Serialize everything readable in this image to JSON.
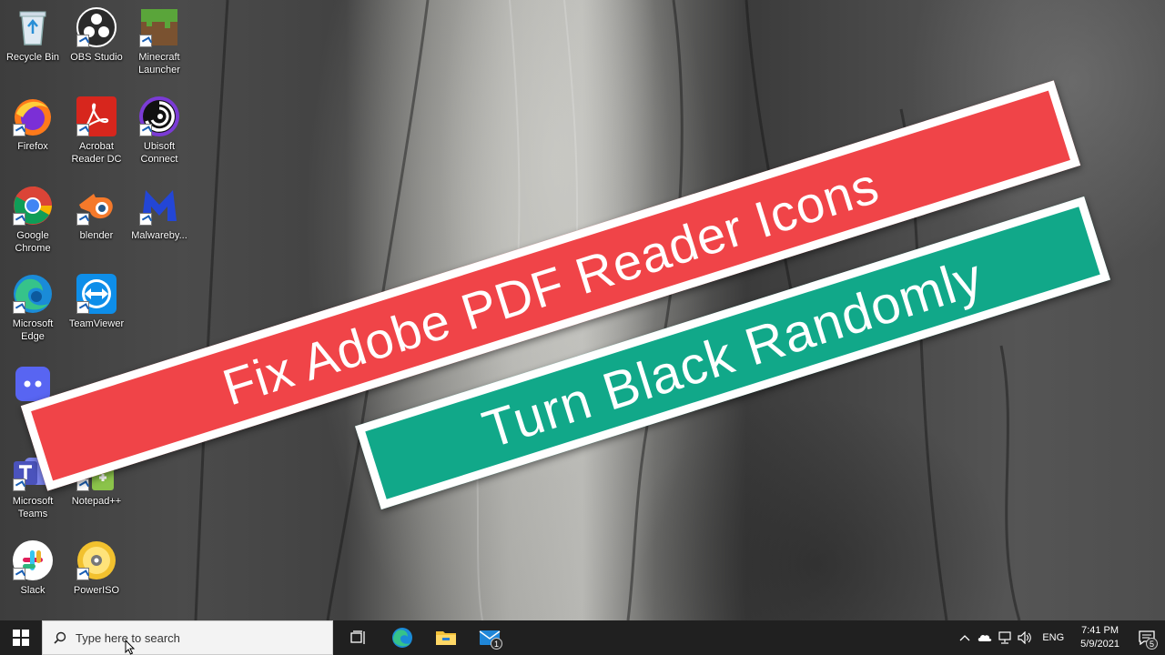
{
  "desktop": {
    "icons": [
      {
        "label": "Recycle Bin",
        "icon": "recycle-bin-icon"
      },
      {
        "label": "OBS Studio",
        "icon": "obs-studio-icon"
      },
      {
        "label": "Minecraft Launcher",
        "icon": "minecraft-icon"
      },
      {
        "label": "Firefox",
        "icon": "firefox-icon"
      },
      {
        "label": "Acrobat Reader DC",
        "icon": "acrobat-reader-icon"
      },
      {
        "label": "Ubisoft Connect",
        "icon": "ubisoft-icon"
      },
      {
        "label": "Google Chrome",
        "icon": "chrome-icon"
      },
      {
        "label": "blender",
        "icon": "blender-icon"
      },
      {
        "label": "Malwareby...",
        "icon": "malwarebytes-icon"
      },
      {
        "label": "Microsoft Edge",
        "icon": "edge-icon"
      },
      {
        "label": "TeamViewer",
        "icon": "teamviewer-icon"
      },
      {
        "label": "",
        "icon": "discord-icon"
      },
      {
        "label": "Microsoft Teams",
        "icon": "teams-icon"
      },
      {
        "label": "Notepad++",
        "icon": "notepad-plus-plus-icon"
      },
      {
        "label": "Slack",
        "icon": "slack-icon"
      },
      {
        "label": "PowerISO",
        "icon": "poweriso-icon"
      }
    ]
  },
  "banner": {
    "line1": "Fix Adobe PDF Reader Icons",
    "line2": "Turn Black Randomly",
    "line1_color": "#f04448",
    "line2_color": "#11a889"
  },
  "taskbar": {
    "search_placeholder": "Type here to search",
    "pinned": [
      "task-view-icon",
      "edge-icon",
      "file-explorer-icon",
      "mail-icon"
    ],
    "mail_badge": "1",
    "language": "ENG",
    "time": "7:41 PM",
    "date": "5/9/2021",
    "notification_count": "5"
  }
}
